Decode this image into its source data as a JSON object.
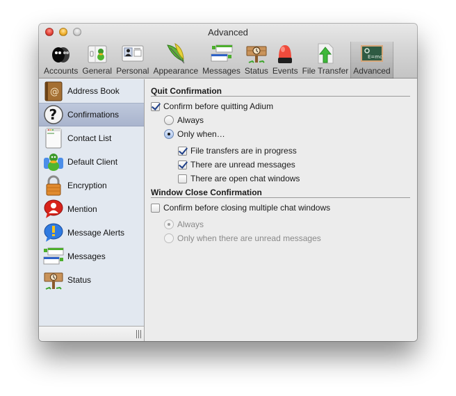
{
  "window": {
    "title": "Advanced"
  },
  "toolbar": {
    "items": [
      {
        "label": "Accounts",
        "icon": "accounts-icon"
      },
      {
        "label": "General",
        "icon": "general-icon"
      },
      {
        "label": "Personal",
        "icon": "personal-icon"
      },
      {
        "label": "Appearance",
        "icon": "appearance-icon"
      },
      {
        "label": "Messages",
        "icon": "messages-icon"
      },
      {
        "label": "Status",
        "icon": "status-icon"
      },
      {
        "label": "Events",
        "icon": "events-icon"
      },
      {
        "label": "File Transfer",
        "icon": "file-transfer-icon"
      },
      {
        "label": "Advanced",
        "icon": "advanced-icon",
        "selected": true
      }
    ]
  },
  "sidebar": {
    "items": [
      {
        "label": "Address Book",
        "icon": "address-book-icon"
      },
      {
        "label": "Confirmations",
        "icon": "question-icon",
        "selected": true
      },
      {
        "label": "Contact List",
        "icon": "contact-list-icon"
      },
      {
        "label": "Default Client",
        "icon": "default-client-icon"
      },
      {
        "label": "Encryption",
        "icon": "lock-icon"
      },
      {
        "label": "Mention",
        "icon": "mention-icon"
      },
      {
        "label": "Message Alerts",
        "icon": "message-alerts-icon"
      },
      {
        "label": "Messages",
        "icon": "messages-icon"
      },
      {
        "label": "Status",
        "icon": "status-icon"
      }
    ]
  },
  "quit": {
    "title": "Quit Confirmation",
    "confirm_label": "Confirm before quitting Adium",
    "confirm_checked": true,
    "always_label": "Always",
    "always_selected": false,
    "only_when_label": "Only when…",
    "only_when_selected": true,
    "conditions": [
      {
        "label": "File transfers are in progress",
        "checked": true
      },
      {
        "label": "There are unread messages",
        "checked": true
      },
      {
        "label": "There are open chat windows",
        "checked": false
      }
    ]
  },
  "close": {
    "title": "Window Close Confirmation",
    "confirm_label": "Confirm before closing multiple chat windows",
    "confirm_checked": false,
    "always_label": "Always",
    "always_selected": true,
    "unread_label": "Only when there are unread messages",
    "unread_selected": false,
    "options_enabled": false
  },
  "colors": {
    "selection": "#aeb9d0",
    "sidebar_bg": "#e2e8f0",
    "content_bg": "#ececec",
    "checkmark": "#1e3f88"
  }
}
